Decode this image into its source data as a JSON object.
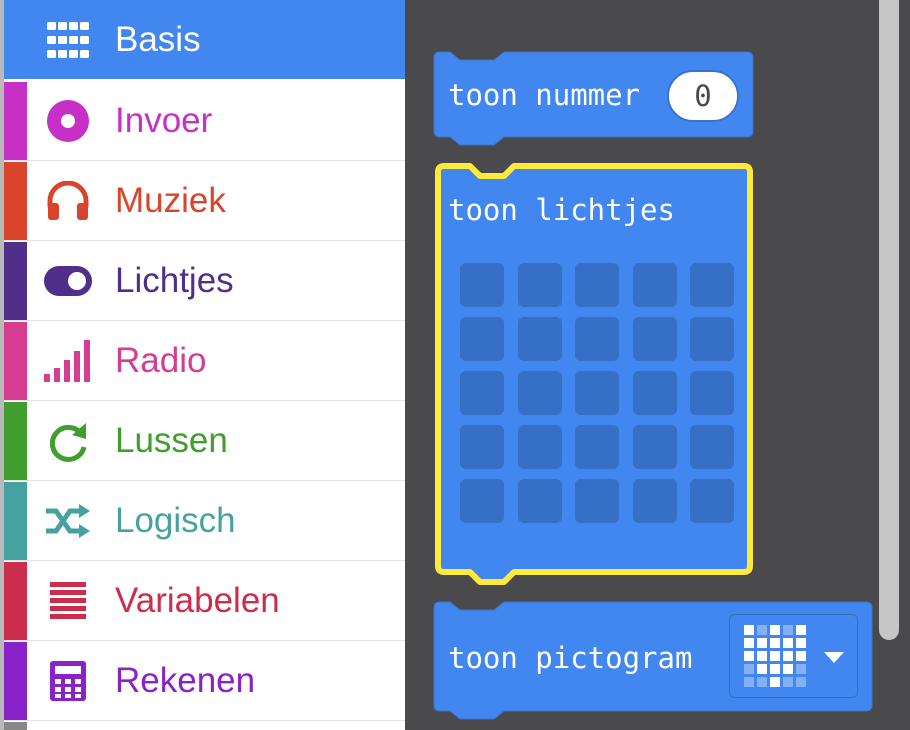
{
  "toolbox": {
    "categories": [
      {
        "label": "Basis",
        "color": "#ffffff",
        "bar_color": "#4286f0",
        "icon": "grid-icon",
        "selected": true
      },
      {
        "label": "Invoer",
        "color": "#c730c7",
        "bar_color": "#c730c7",
        "icon": "radio-button-icon"
      },
      {
        "label": "Muziek",
        "color": "#d9442c",
        "bar_color": "#d9442c",
        "icon": "headphones-icon"
      },
      {
        "label": "Lichtjes",
        "color": "#4f2f8a",
        "bar_color": "#4f2f8a",
        "icon": "toggle-icon"
      },
      {
        "label": "Radio",
        "color": "#d63c8f",
        "bar_color": "#d63c8f",
        "icon": "signal-bars-icon"
      },
      {
        "label": "Lussen",
        "color": "#3f9e2e",
        "bar_color": "#3f9e2e",
        "icon": "refresh-icon"
      },
      {
        "label": "Logisch",
        "color": "#45a2a0",
        "bar_color": "#45a2a0",
        "icon": "shuffle-icon"
      },
      {
        "label": "Variabelen",
        "color": "#cc2d4b",
        "bar_color": "#cc2d4b",
        "icon": "list-icon"
      },
      {
        "label": "Rekenen",
        "color": "#8a22c9",
        "bar_color": "#8a22c9",
        "icon": "calculator-icon"
      }
    ]
  },
  "blocks": {
    "show_number": {
      "label": "toon nummer",
      "value": "0"
    },
    "show_leds": {
      "label": "toon lichtjes",
      "grid_rows": 5,
      "grid_cols": 5
    },
    "show_icon": {
      "label": "toon pictogram",
      "selected_icon": "heart-icon"
    }
  },
  "colors": {
    "block": "#4286f0",
    "block_edge": "#3a74c8",
    "highlight": "#ffe93b",
    "workspace": "#4a4a4c"
  }
}
